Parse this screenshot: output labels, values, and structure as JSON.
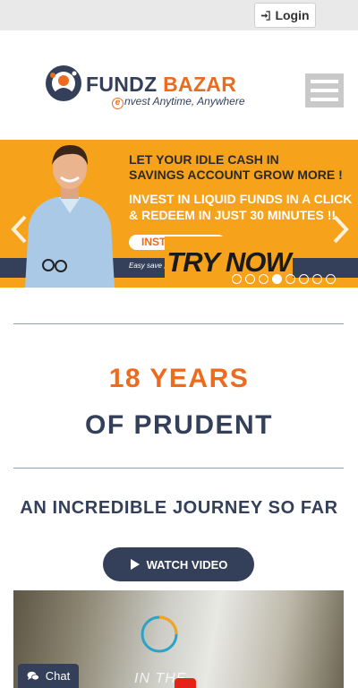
{
  "header": {
    "login_label": "Login",
    "logo": {
      "brand_part1": "FUNDZ",
      "brand_part2": "BAZAR",
      "tagline_prefix": "e",
      "tagline_rest": "nvest Anytime, Anywhere"
    },
    "colors": {
      "brand_navy": "#34405a",
      "brand_orange": "#ec6c1f"
    }
  },
  "banner": {
    "headline": "LET YOUR IDLE CASH IN\nSAVINGS ACCOUNT GROW MORE !",
    "subheadline": "INVEST IN LIQUID FUNDS IN A CLICK\n& REDEEM IN JUST 30 MINUTES !!",
    "cta_label": "INSTANT",
    "strip_text": "Easy save ,",
    "try_now_label": "TRY NOW",
    "slide_count": 8,
    "active_slide": 4,
    "background_color": "#f6a31b"
  },
  "main": {
    "years_text": "18 YEARS",
    "prudent_text": "OF PRUDENT",
    "journey_text": "AN INCREDIBLE JOURNEY SO FAR",
    "watch_video_label": "WATCH VIDEO",
    "video_overlay_text": "IN THE"
  },
  "chat": {
    "label": "Chat"
  }
}
